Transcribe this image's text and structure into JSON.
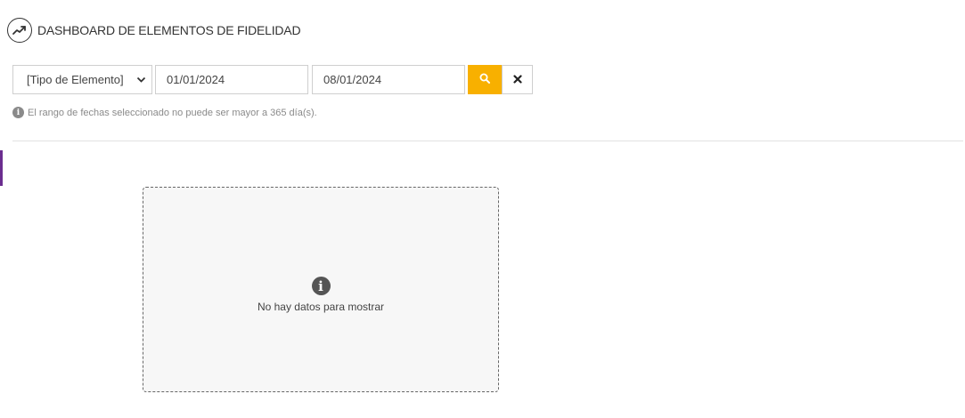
{
  "header": {
    "title": "DASHBOARD DE ELEMENTOS DE FIDELIDAD",
    "icon": "trend-chart-icon"
  },
  "filters": {
    "element_type": {
      "selected": "[Tipo de Elemento]",
      "icon": "chevron-down-icon"
    },
    "date_start": {
      "value": "01/01/2024"
    },
    "date_end": {
      "value": "08/01/2024"
    },
    "search_icon": "search-icon",
    "clear_icon": "close-icon"
  },
  "note": {
    "icon": "info-icon",
    "text": "El rango de fechas seleccionado no puede ser mayor a 365 día(s)."
  },
  "empty_state": {
    "icon": "info-icon",
    "text": "No hay datos para mostrar"
  },
  "colors": {
    "accent": "#f8b000",
    "side_accent": "#6b2d8f",
    "empty_bg": "#f7f7f7"
  }
}
